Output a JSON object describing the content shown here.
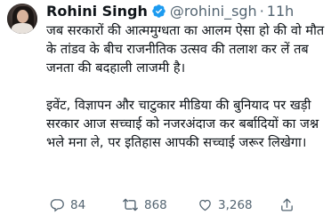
{
  "tweet": {
    "author_name": "Rohini Singh",
    "handle": "@rohini_sgh",
    "separator": "·",
    "time": "11h",
    "paragraph1": "जब सरकारों की आत्ममुग्धता का आलम ऐसा हो की वो मौत के तांडव के बीच राजनीतिक उत्सव की तलाश कर लें तब जनता की बदहाली लाजमी है।",
    "paragraph2": "इवेंट, विज्ञापन और चाटुकार मीडिया की बुनियाद पर खड़ी सरकार आज सच्चाई को नजरअंदाज कर बर्बादियों का जश्न भले मना ले, पर इतिहास आपकी सच्चाई जरूर लिखेगा।"
  },
  "actions": {
    "replies": "84",
    "retweets": "868",
    "likes": "3,268"
  },
  "icons": {
    "verified": "verified-badge-icon",
    "reply": "reply-icon",
    "retweet": "retweet-icon",
    "like": "heart-icon",
    "share": "share-icon"
  },
  "colors": {
    "verified_blue": "#1d9bf0",
    "secondary_text": "#536471"
  }
}
